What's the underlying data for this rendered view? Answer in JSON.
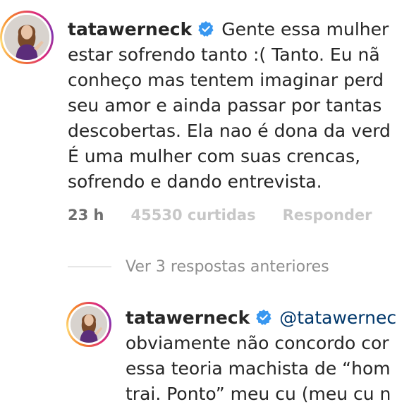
{
  "comment": {
    "username": "tatawerneck",
    "lines": [
      "Gente essa mulher",
      "estar sofrendo tanto :( Tanto. Eu nã",
      "conheço mas tentem imaginar perd",
      "seu amor e ainda passar por tantas",
      "descobertas. Ela nao é dona da verd",
      "É uma mulher com suas crencas,",
      "sofrendo e dando entrevista."
    ],
    "time": "23 h",
    "likes": "45530 curtidas",
    "reply_label": "Responder"
  },
  "view_replies_label": "Ver 3 respostas anteriores",
  "reply": {
    "username": "tatawerneck",
    "mention": "@tatawernec",
    "lines": [
      "obviamente não concordo cor",
      "essa teoria machista de “hom",
      "trai. Ponto” meu cu (meu cu n"
    ]
  },
  "icons": {
    "verified": "verified-badge-icon",
    "avatar": "profile-avatar"
  },
  "colors": {
    "verified_blue": "#3897f0",
    "mention_blue": "#00376b",
    "meta_gray": "#8e8e8e",
    "text": "#262626"
  }
}
